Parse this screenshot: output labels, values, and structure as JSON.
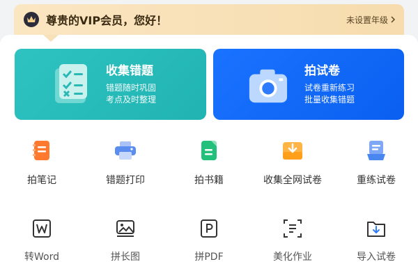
{
  "vip_banner": {
    "title": "尊贵的VIP会员，您好！",
    "grade_link": "未设置年级"
  },
  "cards": [
    {
      "title": "收集错题",
      "sub1": "错题随时巩固",
      "sub2": "考点及时整理"
    },
    {
      "title": "拍试卷",
      "sub1": "试卷重新练习",
      "sub2": "批量收集错题"
    }
  ],
  "tools_row1": [
    {
      "label": "拍笔记",
      "icon": "notebook-icon",
      "color": "#ff7a2e"
    },
    {
      "label": "错题打印",
      "icon": "printer-icon",
      "color": "#5b8def"
    },
    {
      "label": "拍书籍",
      "icon": "book-icon",
      "color": "#22c07a"
    },
    {
      "label": "收集全网试卷",
      "icon": "download-tray-icon",
      "color": "#ff9f1a"
    },
    {
      "label": "重练试卷",
      "icon": "paper-redo-icon",
      "color": "#4a86f0"
    }
  ],
  "tools_row2": [
    {
      "label": "转Word",
      "icon": "word-icon"
    },
    {
      "label": "拼长图",
      "icon": "image-icon"
    },
    {
      "label": "拼PDF",
      "icon": "pdf-icon"
    },
    {
      "label": "美化作业",
      "icon": "beautify-icon"
    },
    {
      "label": "导入试卷",
      "icon": "import-folder-icon"
    }
  ]
}
